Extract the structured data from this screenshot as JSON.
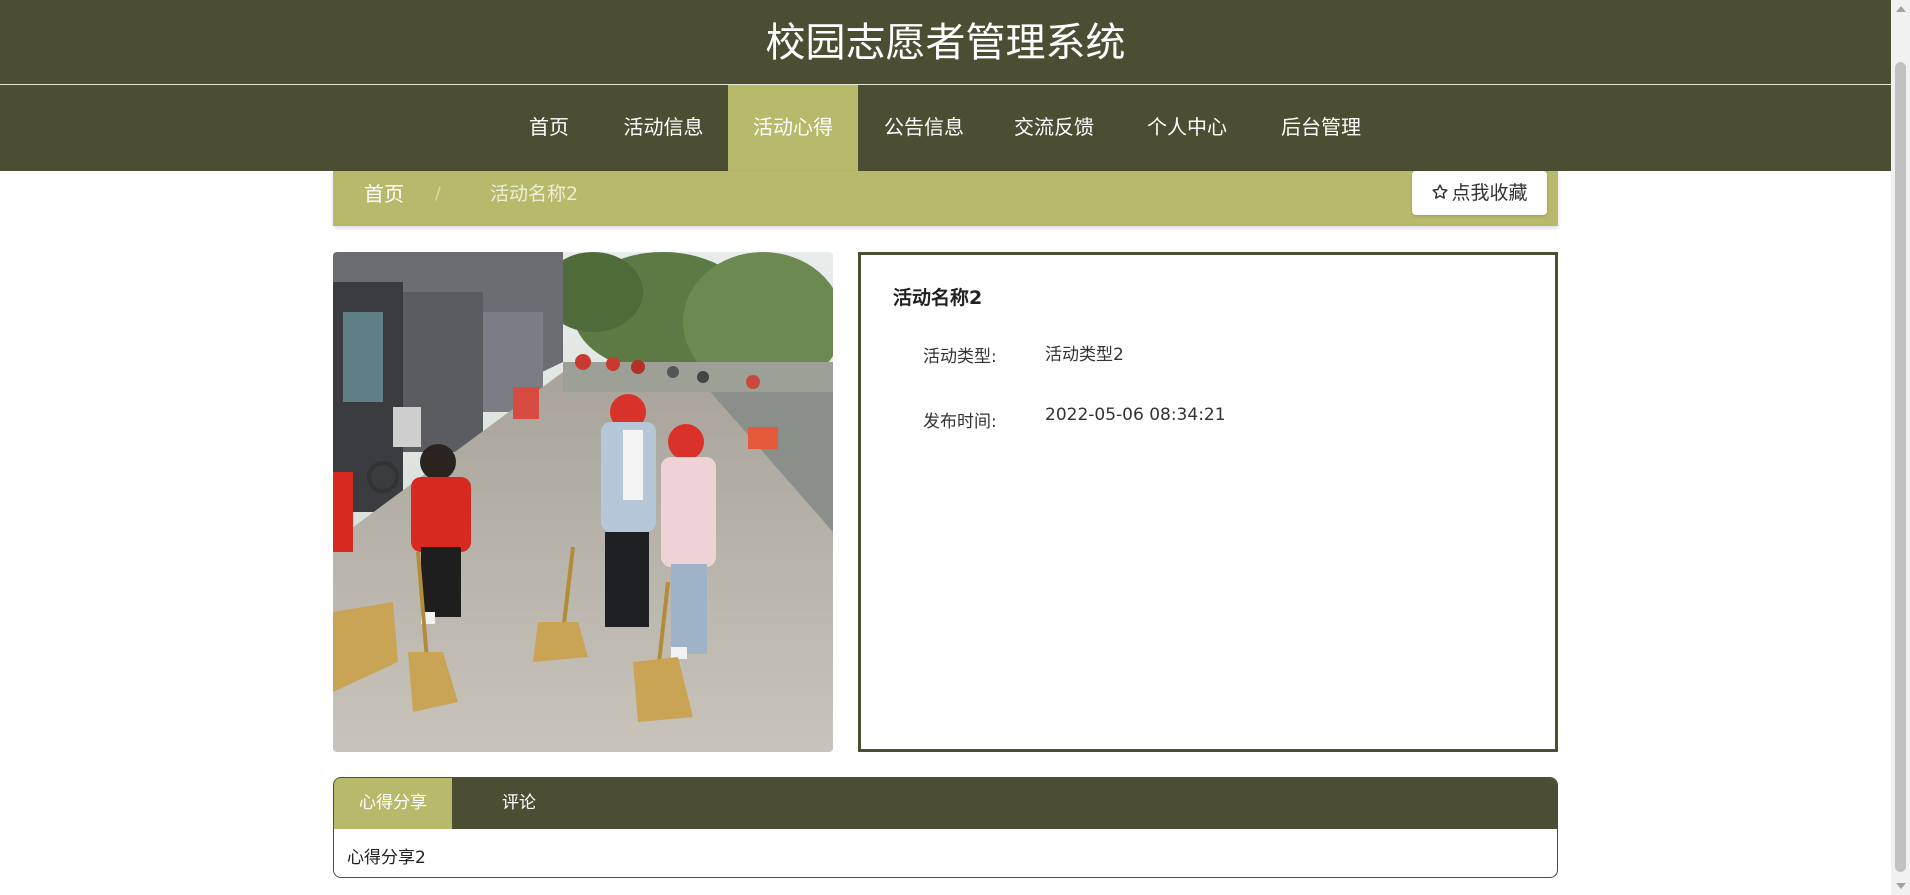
{
  "header": {
    "site_title": "校园志愿者管理系统"
  },
  "nav": {
    "items": [
      {
        "label": "首页"
      },
      {
        "label": "活动信息"
      },
      {
        "label": "活动心得"
      },
      {
        "label": "公告信息"
      },
      {
        "label": "交流反馈"
      },
      {
        "label": "个人中心"
      },
      {
        "label": "后台管理"
      }
    ],
    "active": "活动心得"
  },
  "breadcrumb": {
    "home": "首页",
    "separator": "/",
    "current": "活动名称2"
  },
  "favorite_button": {
    "label": "点我收藏",
    "icon": "star-outline-icon"
  },
  "detail": {
    "photo_alt": "activity-photo",
    "title": "活动名称2",
    "fields": [
      {
        "label": "活动类型:",
        "value": "活动类型2"
      },
      {
        "label": "发布时间:",
        "value": "2022-05-06 08:34:21"
      }
    ]
  },
  "tabs": {
    "items": [
      {
        "label": "心得分享"
      },
      {
        "label": "评论"
      }
    ],
    "active": "心得分享",
    "content": "心得分享2"
  },
  "colors": {
    "primary_dark": "#4c4e33",
    "accent_olive": "#b7ba6b",
    "white": "#ffffff"
  }
}
